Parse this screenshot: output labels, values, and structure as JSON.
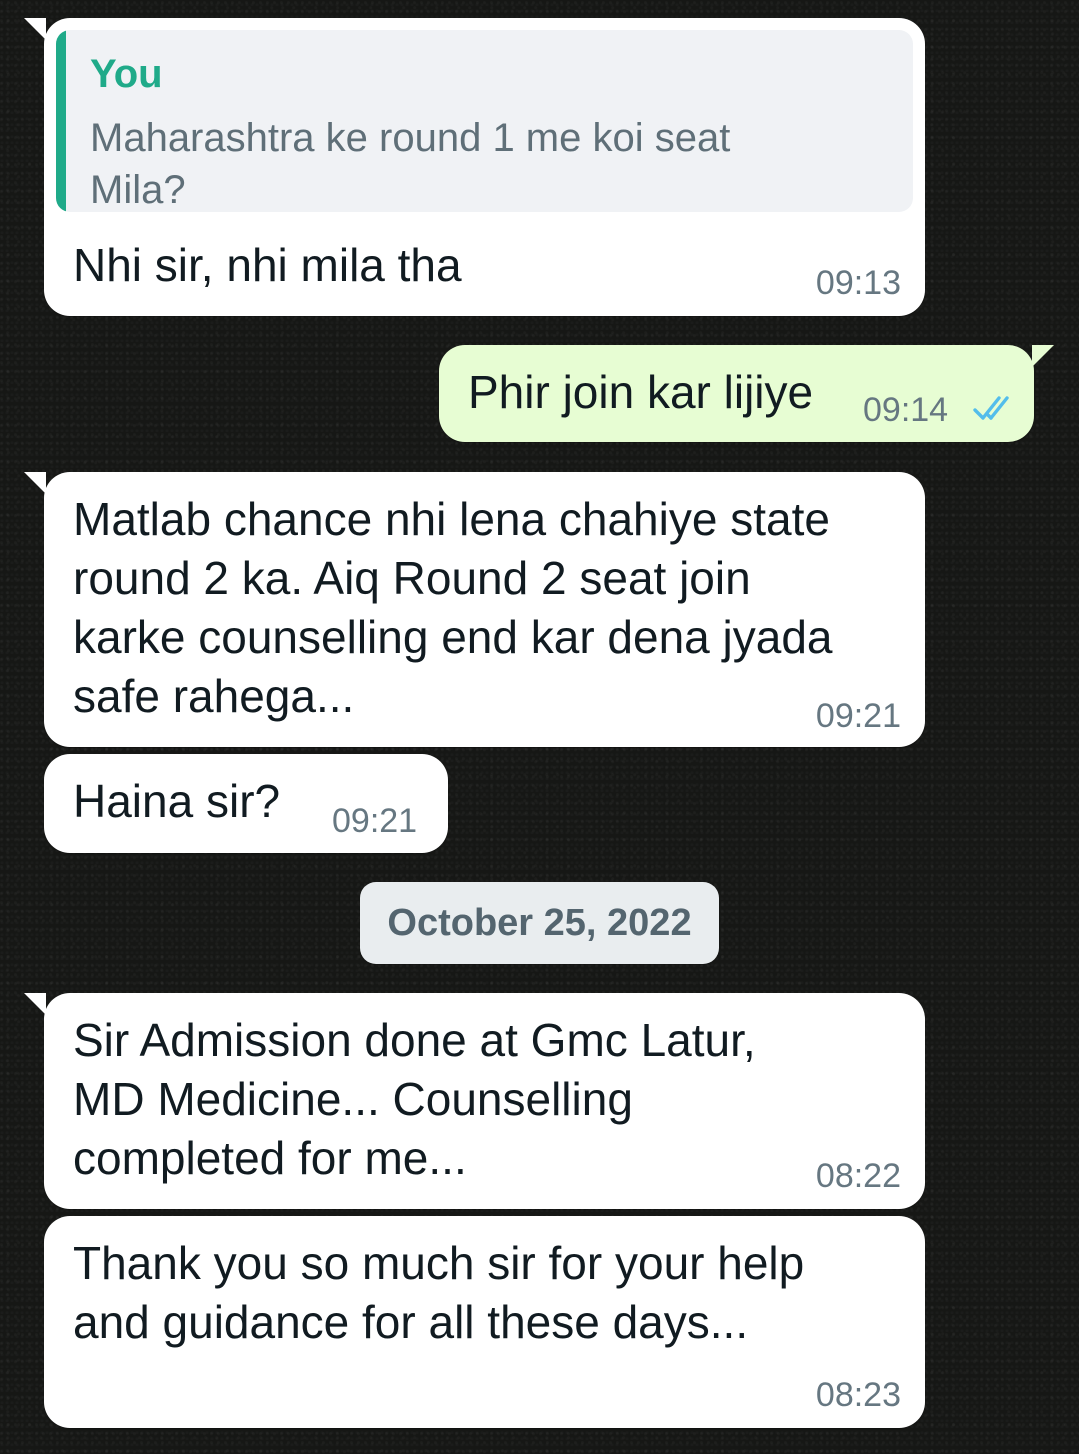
{
  "conversation": {
    "messages": [
      {
        "direction": "incoming",
        "reply": {
          "author": "You",
          "text": "Maharashtra ke round 1 me koi seat\nMila?"
        },
        "text": "Nhi sir, nhi mila tha",
        "time": "09:13"
      },
      {
        "direction": "outgoing",
        "text": "Phir join kar lijiye",
        "time": "09:14",
        "status_icon": "double-check-read-icon",
        "status_color": "#53bdeb"
      },
      {
        "direction": "incoming",
        "text": "Matlab chance nhi lena chahiye state\nround 2 ka. Aiq Round 2 seat join\nkarke counselling end kar dena jyada\nsafe rahega...",
        "time": "09:21"
      },
      {
        "direction": "incoming",
        "text": "Haina sir?",
        "time": "09:21"
      },
      {
        "direction": "incoming",
        "text": "Sir Admission done at Gmc Latur,\nMD Medicine... Counselling\ncompleted for me...",
        "time": "08:22"
      },
      {
        "direction": "incoming",
        "text": "Thank you so much sir for your help\nand guidance for all these days...",
        "time": "08:23"
      }
    ],
    "date_separator": "October 25, 2022"
  },
  "colors": {
    "incoming_bubble": "#ffffff",
    "outgoing_bubble": "#e7fdd3",
    "quote_accent": "#1faa89",
    "read_ticks": "#53bdeb",
    "timestamp": "#667781"
  }
}
